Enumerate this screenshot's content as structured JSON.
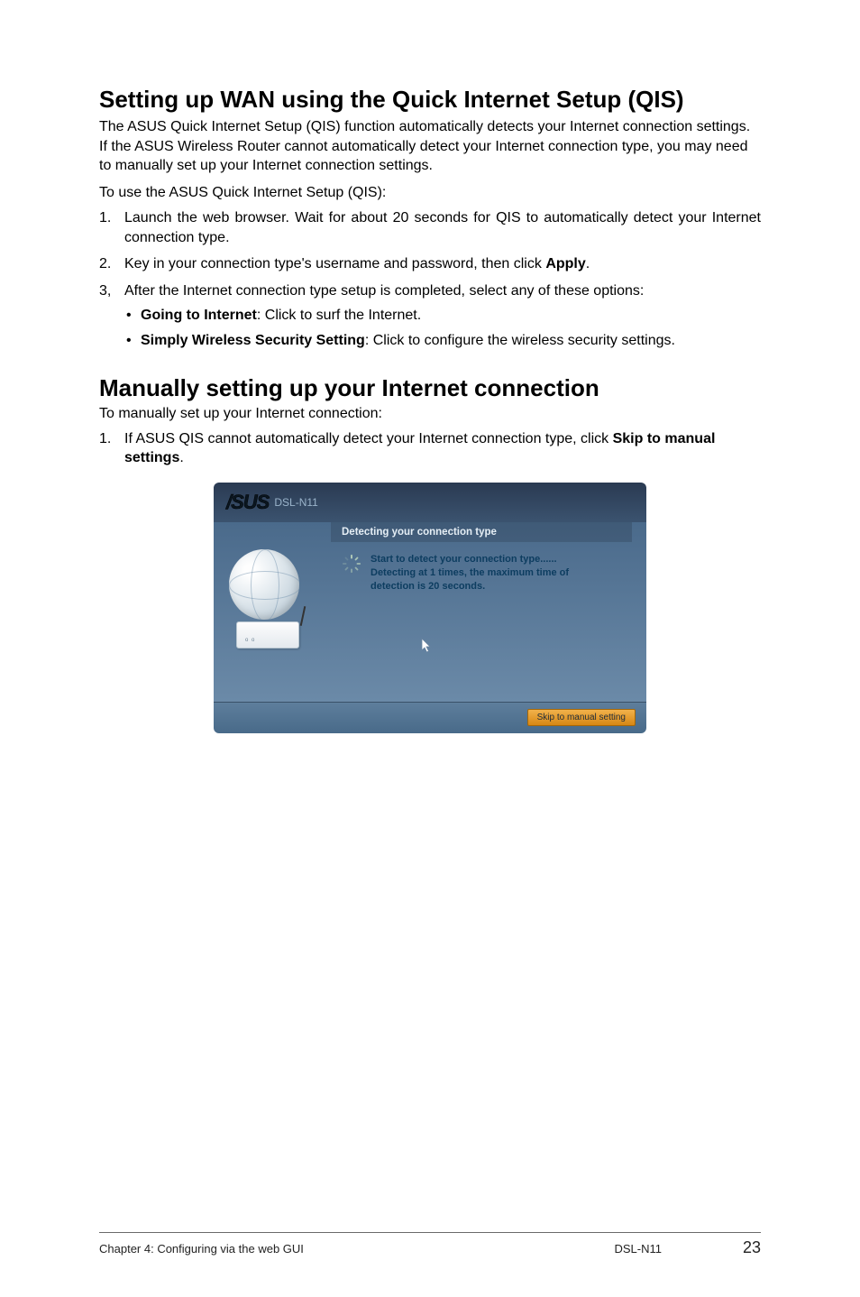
{
  "heading1": "Setting up WAN using the Quick Internet Setup (QIS)",
  "intro1": "The ASUS Quick Internet Setup (QIS) function automatically detects your Internet connection settings. If the ASUS Wireless Router cannot automatically detect your Internet connection type, you may need to manually set up your Internet connection settings.",
  "lead1": "To use the ASUS Quick Internet Setup (QIS):",
  "steps1": {
    "s1_num": "1.",
    "s1": "Launch the web browser. Wait for about 20 seconds for QIS to automatically detect your Internet connection type.",
    "s2_num": "2.",
    "s2_pre": "Key in your connection type's username and password, then click ",
    "s2_bold": "Apply",
    "s2_post": ".",
    "s3_num": "3,",
    "s3": "After the Internet connection type setup is completed, select any of these options:",
    "b1_bold": "Going to Internet",
    "b1_rest": ": Click to surf the Internet.",
    "b2_bold": "Simply Wireless Security Setting",
    "b2_rest": ": Click to configure the wireless security settings."
  },
  "heading2": "Manually setting up your Internet connection",
  "lead2": "To manually set up your Internet connection:",
  "steps2": {
    "s1_num": "1.",
    "s1_pre": "If ASUS QIS cannot automatically detect your Internet connection type, click ",
    "s1_bold": "Skip to manual settings",
    "s1_post": "."
  },
  "screenshot": {
    "brand": "/SUS",
    "model": "DSL-N11",
    "header": "Detecting your connection type",
    "msg1": "Start to detect your connection type......",
    "msg2": "Detecting at 1 times, the maximum time of",
    "msg3": "detection is 20 seconds.",
    "dots": "o o",
    "button": "Skip to manual setting"
  },
  "footer": {
    "left": "Chapter 4: Configuring via the web GUI",
    "model": "DSL-N11",
    "page": "23"
  }
}
